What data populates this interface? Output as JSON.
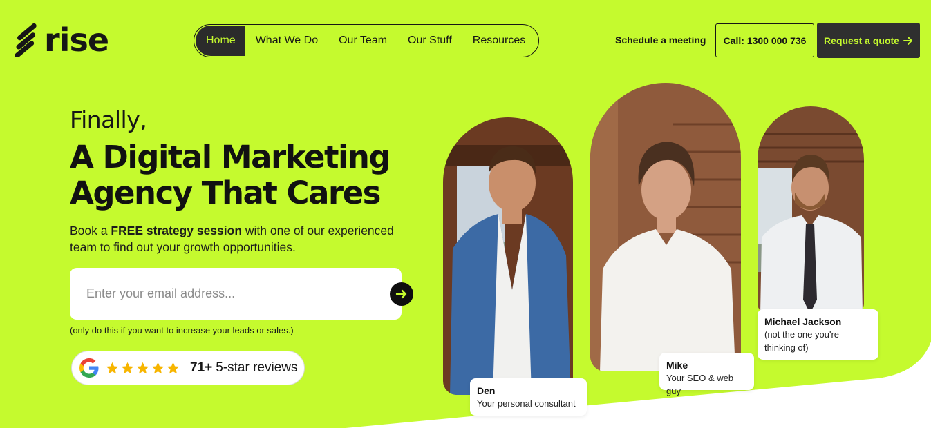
{
  "brand": {
    "name": "rise"
  },
  "nav": {
    "items": [
      {
        "label": "Home",
        "active": true
      },
      {
        "label": "What We Do",
        "active": false
      },
      {
        "label": "Our Team",
        "active": false
      },
      {
        "label": "Our Stuff",
        "active": false
      },
      {
        "label": "Resources",
        "active": false
      }
    ]
  },
  "header": {
    "schedule_label": "Schedule a meeting",
    "call_label": "Call: 1300 000 736",
    "quote_label": "Request a quote",
    "quote_icon": "arrow-right-icon"
  },
  "hero": {
    "eyebrow": "Finally,",
    "headline_line1": "A Digital Marketing",
    "headline_line2": "Agency That Cares",
    "sub_pre": "Book a ",
    "sub_bold": "FREE strategy session",
    "sub_post": " with one of our experienced team to find out your growth opportunities.",
    "email_placeholder": "Enter your email address...",
    "submit_icon": "arrow-right-icon",
    "disclaimer": "(only do this if you want to increase your leads or sales.)"
  },
  "reviews": {
    "icon": "google-icon",
    "stars": 5,
    "count": "71+",
    "label": "5-star reviews"
  },
  "team": [
    {
      "name": "Den",
      "role": "Your personal consultant"
    },
    {
      "name": "Mike",
      "role": "Your SEO & web guy"
    },
    {
      "name": "Michael Jackson",
      "role": "(not the one you're thinking of)"
    }
  ],
  "colors": {
    "accent_lime": "#c5fa2e",
    "dark": "#2f2f2f",
    "star_gold": "#f7b500"
  }
}
